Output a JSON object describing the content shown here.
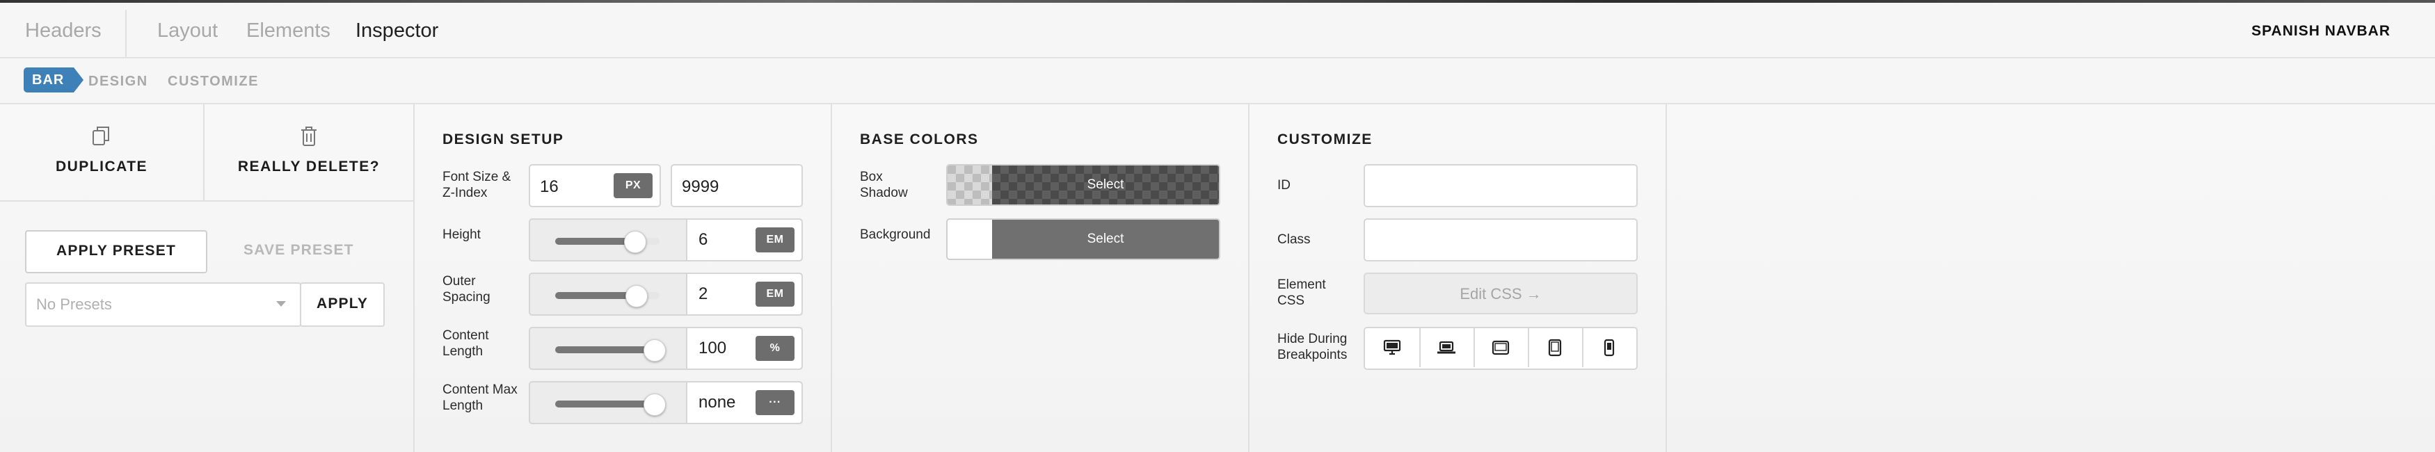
{
  "tabs": {
    "items": [
      "Headers",
      "Layout",
      "Elements",
      "Inspector"
    ],
    "active": "Inspector"
  },
  "brand": "SPANISH NAVBAR",
  "subtabs": {
    "active": "BAR",
    "items": [
      "DESIGN",
      "CUSTOMIZE"
    ]
  },
  "actions": {
    "duplicate": "DUPLICATE",
    "delete": "REALLY DELETE?"
  },
  "presets": {
    "apply_preset": "APPLY PRESET",
    "save_preset": "SAVE PRESET",
    "select_placeholder": "No Presets",
    "apply": "APPLY"
  },
  "design": {
    "title": "DESIGN SETUP",
    "font_size": {
      "label": "Font Size & Z-Index",
      "value": "16",
      "unit": "PX",
      "zindex": "9999"
    },
    "height": {
      "label": "Height",
      "value": "6",
      "unit": "EM",
      "slider": 0.8
    },
    "outer_spacing": {
      "label": "Outer Spacing",
      "value": "2",
      "unit": "EM",
      "slider": 0.82
    },
    "content_length": {
      "label": "Content Length",
      "value": "100",
      "unit": "%",
      "slider": 1.0
    },
    "content_max_length": {
      "label": "Content Max Length",
      "value": "none",
      "unit": "···",
      "slider": 1.0
    }
  },
  "colors": {
    "title": "BASE COLORS",
    "box_shadow": {
      "label": "Box Shadow",
      "button": "Select"
    },
    "background": {
      "label": "Background",
      "button": "Select"
    },
    "accent": "#3e80b8",
    "swatch_grey": "#707070"
  },
  "customize": {
    "title": "CUSTOMIZE",
    "id": {
      "label": "ID",
      "value": ""
    },
    "class": {
      "label": "Class",
      "value": ""
    },
    "element_css": {
      "label": "Element CSS",
      "button": "Edit CSS →"
    },
    "hide_breakpoints": {
      "label": "Hide During Breakpoints",
      "icons": [
        "desktop-icon",
        "laptop-icon",
        "tablet-landscape-icon",
        "tablet-portrait-icon",
        "phone-icon"
      ]
    }
  }
}
